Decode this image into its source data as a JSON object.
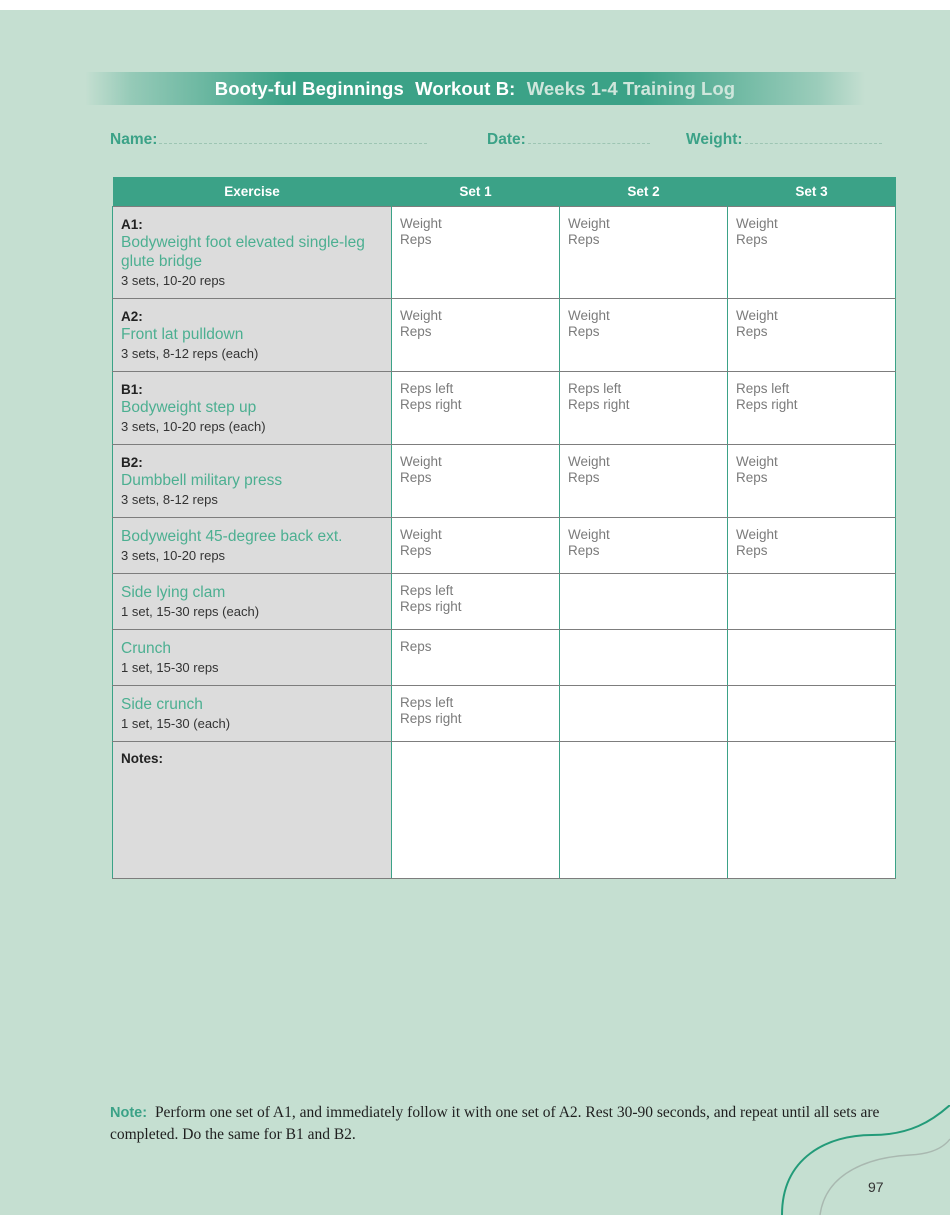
{
  "header": {
    "title_bold": "Booty-ful Beginnings",
    "title_mid": "Workout B:",
    "title_light": "Weeks 1-4 Training Log"
  },
  "form": {
    "name_label": "Name:",
    "date_label": "Date:",
    "weight_label": "Weight:"
  },
  "table": {
    "columns": [
      "Exercise",
      "Set 1",
      "Set 2",
      "Set 3"
    ],
    "rows": [
      {
        "code": "A1:",
        "name": "Bodyweight foot elevated single-leg glute bridge",
        "prescription": "3 sets, 10-20 reps",
        "set1": [
          "Weight",
          "Reps"
        ],
        "set2": [
          "Weight",
          "Reps"
        ],
        "set3": [
          "Weight",
          "Reps"
        ]
      },
      {
        "code": "A2:",
        "name": "Front lat pulldown",
        "prescription": "3 sets, 8-12 reps (each)",
        "set1": [
          "Weight",
          "Reps"
        ],
        "set2": [
          "Weight",
          "Reps"
        ],
        "set3": [
          "Weight",
          "Reps"
        ]
      },
      {
        "code": "B1:",
        "name": "Bodyweight step up",
        "prescription": "3 sets, 10-20 reps (each)",
        "set1": [
          "Reps left",
          "Reps right"
        ],
        "set2": [
          "Reps left",
          "Reps right"
        ],
        "set3": [
          "Reps left",
          "Reps right"
        ]
      },
      {
        "code": "B2:",
        "name": "Dumbbell military press",
        "prescription": "3 sets, 8-12 reps",
        "set1": [
          "Weight",
          "Reps"
        ],
        "set2": [
          "Weight",
          "Reps"
        ],
        "set3": [
          "Weight",
          "Reps"
        ]
      },
      {
        "code": "",
        "name": "Bodyweight 45-degree back ext.",
        "prescription": "3 sets, 10-20 reps",
        "set1": [
          "Weight",
          "Reps"
        ],
        "set2": [
          "Weight",
          "Reps"
        ],
        "set3": [
          "Weight",
          "Reps"
        ]
      },
      {
        "code": "",
        "name": "Side lying clam",
        "prescription": "1 set, 15-30 reps (each)",
        "set1": [
          "Reps left",
          "Reps right"
        ],
        "set2": [
          "",
          ""
        ],
        "set3": [
          "",
          ""
        ]
      },
      {
        "code": "",
        "name": "Crunch",
        "prescription": "1 set, 15-30 reps",
        "set1": [
          "Reps",
          ""
        ],
        "set2": [
          "",
          ""
        ],
        "set3": [
          "",
          ""
        ]
      },
      {
        "code": "",
        "name": "Side crunch",
        "prescription": "1 set, 15-30 (each)",
        "set1": [
          "Reps left",
          "Reps right"
        ],
        "set2": [
          "",
          ""
        ],
        "set3": [
          "",
          ""
        ]
      }
    ],
    "notes_label": "Notes:"
  },
  "footer": {
    "note_label": "Note:",
    "note_text": "Perform one set of A1, and immediately follow it with one set of A2. Rest 30-90 seconds, and repeat until all sets are completed. Do the same for B1 and B2.",
    "page_number": "97"
  },
  "colors": {
    "page_background": "#c5dfd1",
    "teal": "#3ba287",
    "exercise_name": "#4caf91",
    "cell_gray": "#dcdcdc"
  }
}
